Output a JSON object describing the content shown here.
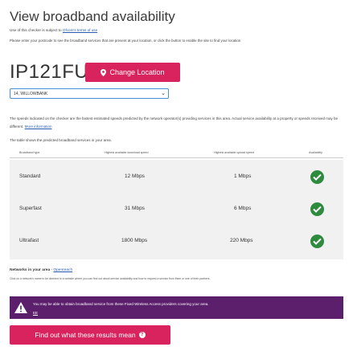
{
  "header": {
    "title": "View broadband availability",
    "terms_prefix": "Use of this checker is subject to",
    "terms_link": "Ofcom's terms of use",
    "instructions": "Please enter your postcode to see the broadband services that are present at your location, or click the button to enable the site to find your location"
  },
  "location": {
    "postcode": "IP121FU",
    "change_button": "Change Location",
    "address_selected": "14, WILLOWBANK"
  },
  "notes": {
    "speeds_note": "The speeds indicated on the checker are the fastest estimated speeds predicted by the network operator(s) providing services in this area. Actual service availability at a property or speeds received may be different.",
    "more_info_link": "More information",
    "table_note": "The table shows the predicted broadband services in your area."
  },
  "table": {
    "headers": [
      "Broadband type",
      "Highest available download speed",
      "Highest available upload speed",
      "Availability"
    ],
    "rows": [
      {
        "type": "Standard",
        "download": "12 Mbps",
        "upload": "1 Mbps",
        "available": true
      },
      {
        "type": "Superfast",
        "download": "31 Mbps",
        "upload": "6 Mbps",
        "available": true
      },
      {
        "type": "Ultrafast",
        "download": "1800 Mbps",
        "upload": "220 Mbps",
        "available": true
      }
    ]
  },
  "networks": {
    "label": "Networks in your area",
    "separator": " - ",
    "link": "Openreach",
    "subtext": "Click on a network's name to be directed to a website where you can find out about service availability and how to request a service from them or one of their partners."
  },
  "warning": {
    "text": "You may be able to obtain broadband service from these Fixed Wireless Access providers covering your area.",
    "link": "EE",
    "color": "#5b1f6b"
  },
  "actions": {
    "results_button": "Find out what these results mean",
    "accent_color": "#d8235f"
  }
}
